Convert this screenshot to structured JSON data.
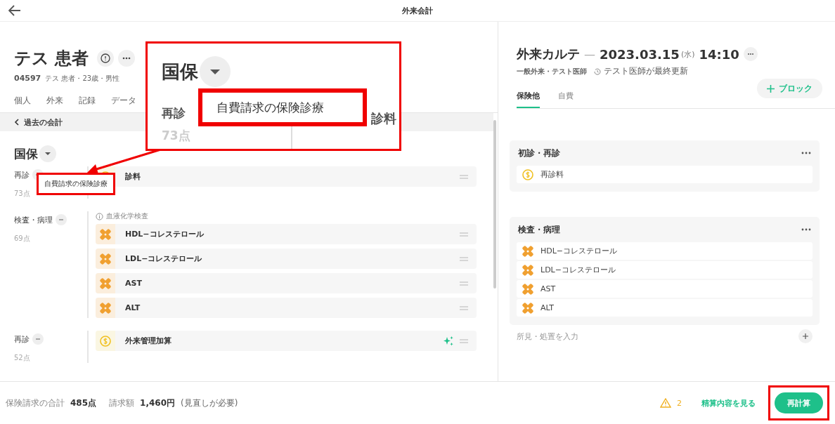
{
  "topbar": {
    "title": "外来会計"
  },
  "patient": {
    "name": "テス 患者",
    "id": "04597",
    "info": "テス 患者・23歳・男性"
  },
  "patient_tabs": [
    "個人",
    "外来",
    "記録",
    "データ"
  ],
  "past_link": "過去の会計",
  "insurance": "国保",
  "groups": [
    {
      "label": "再診",
      "points": "73点",
      "items": [
        {
          "kind": "fee",
          "label": "診料",
          "suggested": false
        }
      ]
    },
    {
      "label": "検査・病理",
      "points": "69点",
      "note": "血液化学検査",
      "items": [
        {
          "kind": "test",
          "label": "HDL−コレステロール",
          "suggested": false
        },
        {
          "kind": "test",
          "label": "LDL−コレステロール",
          "suggested": false
        },
        {
          "kind": "test",
          "label": "AST",
          "suggested": false
        },
        {
          "kind": "test",
          "label": "ALT",
          "suggested": false
        }
      ]
    },
    {
      "label": "再診",
      "points": "52点",
      "items": [
        {
          "kind": "fee",
          "label": "外来管理加算",
          "suggested": true
        }
      ]
    }
  ],
  "dropdown_popup": {
    "label": "自費請求の保険診療"
  },
  "callout": {
    "insurance": "国保",
    "group_label": "再診",
    "group_points": "73点",
    "popup_label": "自費請求の保険診療",
    "item_fragment": "診料"
  },
  "chart": {
    "title": "外来カルテ",
    "separator": "—",
    "date": "2023.03.15",
    "weekday": "(水)",
    "time": "14:10",
    "department": "一般外来・テスト医師",
    "updated": "テスト医師が最終更新",
    "tabs": [
      {
        "label": "保険他",
        "selected": true
      },
      {
        "label": "自費",
        "selected": false
      }
    ],
    "add_block": "ブロック",
    "blocks": [
      {
        "title": "初診・再診",
        "items": [
          {
            "kind": "fee",
            "label": "再診料"
          }
        ]
      },
      {
        "title": "検査・病理",
        "items": [
          {
            "kind": "test",
            "label": "HDL−コレステロール"
          },
          {
            "kind": "test",
            "label": "LDL−コレステロール"
          },
          {
            "kind": "test",
            "label": "AST"
          },
          {
            "kind": "test",
            "label": "ALT"
          }
        ]
      }
    ],
    "findings_placeholder": "所見・処置を入力"
  },
  "footer": {
    "total_label": "保険請求の合計",
    "total": "485点",
    "billing_label": "請求額",
    "billing": "1,460円",
    "billing_note": "(見直しが必要)",
    "warnings": "2",
    "view_link": "精算内容を見る",
    "recalc": "再計算"
  }
}
